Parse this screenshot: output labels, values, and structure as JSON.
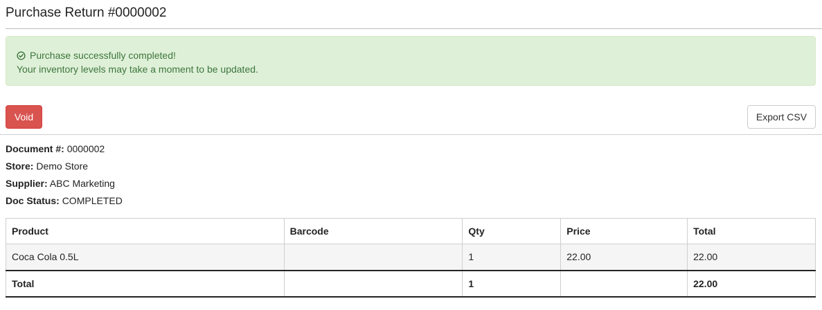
{
  "page": {
    "title": "Purchase Return #0000002"
  },
  "alert": {
    "line1": "Purchase successfully completed!",
    "line2": "Your inventory levels may take a moment to be updated.",
    "icon": "check-circle-icon",
    "color": "#3c763d",
    "background": "#dff0d8"
  },
  "toolbar": {
    "void_label": "Void",
    "export_label": "Export CSV",
    "void_color": "#d9534f"
  },
  "details": {
    "document_label": "Document #:",
    "document_value": "0000002",
    "store_label": "Store:",
    "store_value": "Demo Store",
    "supplier_label": "Supplier:",
    "supplier_value": "ABC Marketing",
    "status_label": "Doc Status:",
    "status_value": "COMPLETED"
  },
  "table": {
    "headers": [
      "Product",
      "Barcode",
      "Qty",
      "Price",
      "Total"
    ],
    "rows": [
      {
        "product": "Coca Cola 0.5L",
        "barcode": "",
        "qty": "1",
        "price": "22.00",
        "total": "22.00"
      }
    ],
    "footer": {
      "label": "Total",
      "barcode": "",
      "qty": "1",
      "price": "",
      "total": "22.00"
    }
  }
}
